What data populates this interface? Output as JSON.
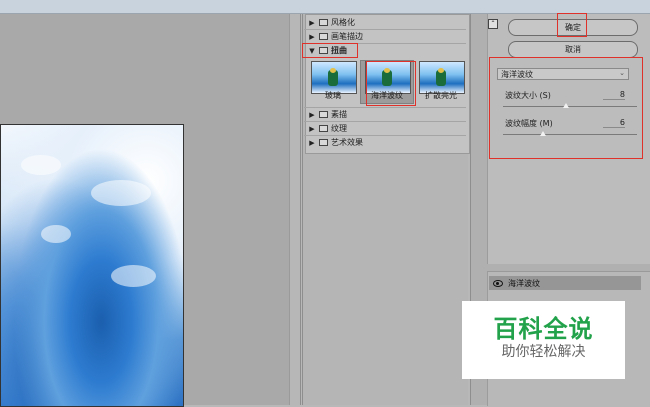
{
  "filter_categories": [
    {
      "label": "风格化",
      "expanded": false
    },
    {
      "label": "画笔描边",
      "expanded": false
    },
    {
      "label": "扭曲",
      "expanded": true
    },
    {
      "label": "素描",
      "expanded": false
    },
    {
      "label": "纹理",
      "expanded": false
    },
    {
      "label": "艺术效果",
      "expanded": false
    }
  ],
  "distort_thumbnails": [
    "玻璃",
    "海洋波纹",
    "扩散亮光"
  ],
  "selected_filter": "海洋波纹",
  "buttons": {
    "ok": "确定",
    "cancel": "取消"
  },
  "filter_dropdown_value": "海洋波纹",
  "params": [
    {
      "label": "波纹大小 (S)",
      "value": "8",
      "fraction": 0.47
    },
    {
      "label": "波纹幅度 (M)",
      "value": "6",
      "fraction": 0.3
    }
  ],
  "effect_layer": "海洋波纹",
  "watermark": {
    "title": "百科全说",
    "subtitle": "助你轻松解决"
  },
  "colors": {
    "highlight": "#e0302a",
    "watermark_green": "#22a24a"
  }
}
